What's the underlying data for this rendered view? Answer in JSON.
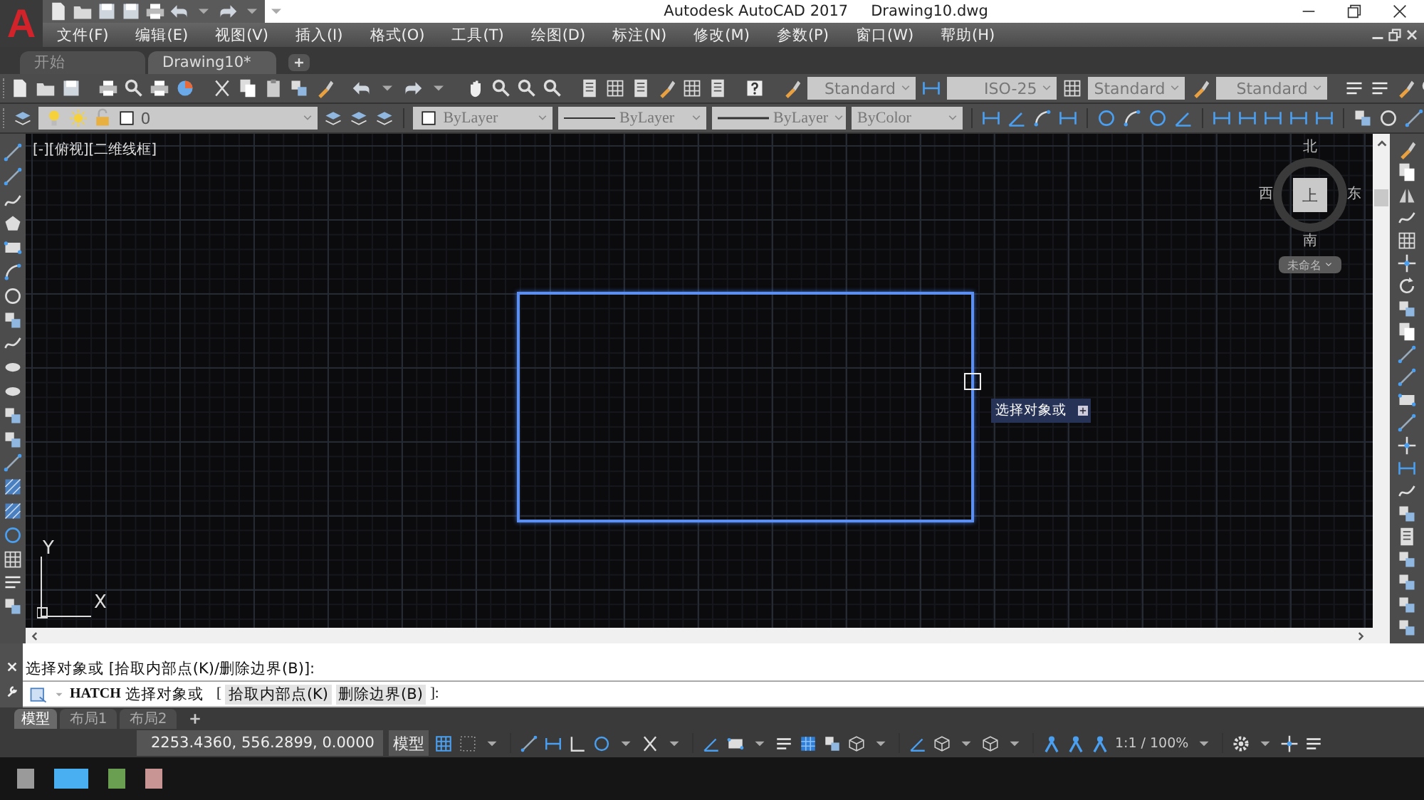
{
  "app": {
    "logo": "A",
    "title": "Autodesk AutoCAD 2017",
    "file": "Drawing10.dwg"
  },
  "menu": [
    "文件(F)",
    "编辑(E)",
    "视图(V)",
    "插入(I)",
    "格式(O)",
    "工具(T)",
    "绘图(D)",
    "标注(N)",
    "修改(M)",
    "参数(P)",
    "窗口(W)",
    "帮助(H)"
  ],
  "doc_tabs": [
    {
      "label": "开始",
      "selected": false
    },
    {
      "label": "Drawing10*",
      "selected": true
    }
  ],
  "style_combos": [
    {
      "kind": "text",
      "value": "Standard"
    },
    {
      "kind": "dim",
      "value": "ISO-25"
    },
    {
      "kind": "table",
      "value": "Standard"
    },
    {
      "kind": "mleader",
      "value": "Standard"
    }
  ],
  "layer": {
    "value": "0"
  },
  "property_combos": [
    {
      "kind": "color",
      "value": "ByLayer"
    },
    {
      "kind": "linetype",
      "value": "ByLayer"
    },
    {
      "kind": "lineweight",
      "value": "ByLayer"
    },
    {
      "kind": "plotstyle",
      "value": "ByColor"
    }
  ],
  "viewport": {
    "label": "[-][俯视][二维线框]"
  },
  "viewcube": {
    "north": "北",
    "south": "南",
    "west": "西",
    "east": "东",
    "face": "上",
    "view_menu": "未命名"
  },
  "ucs": {
    "x": "X",
    "y": "Y"
  },
  "tooltip": {
    "text": "选择对象或"
  },
  "command": {
    "history": "选择对象或  [拾取内部点(K)/删除边界(B)]:",
    "command": "HATCH",
    "prompt": "选择对象或",
    "open": "[",
    "options": [
      "拾取内部点(K)",
      "删除边界(B)"
    ],
    "close": "]:"
  },
  "layout_tabs": [
    {
      "label": "模型",
      "selected": true
    },
    {
      "label": "布局1",
      "selected": false
    },
    {
      "label": "布局2",
      "selected": false
    }
  ],
  "status": {
    "coordinates": "2253.4360, 556.2899, 0.0000",
    "space": "模型",
    "scale": "1:1 / 100%"
  }
}
